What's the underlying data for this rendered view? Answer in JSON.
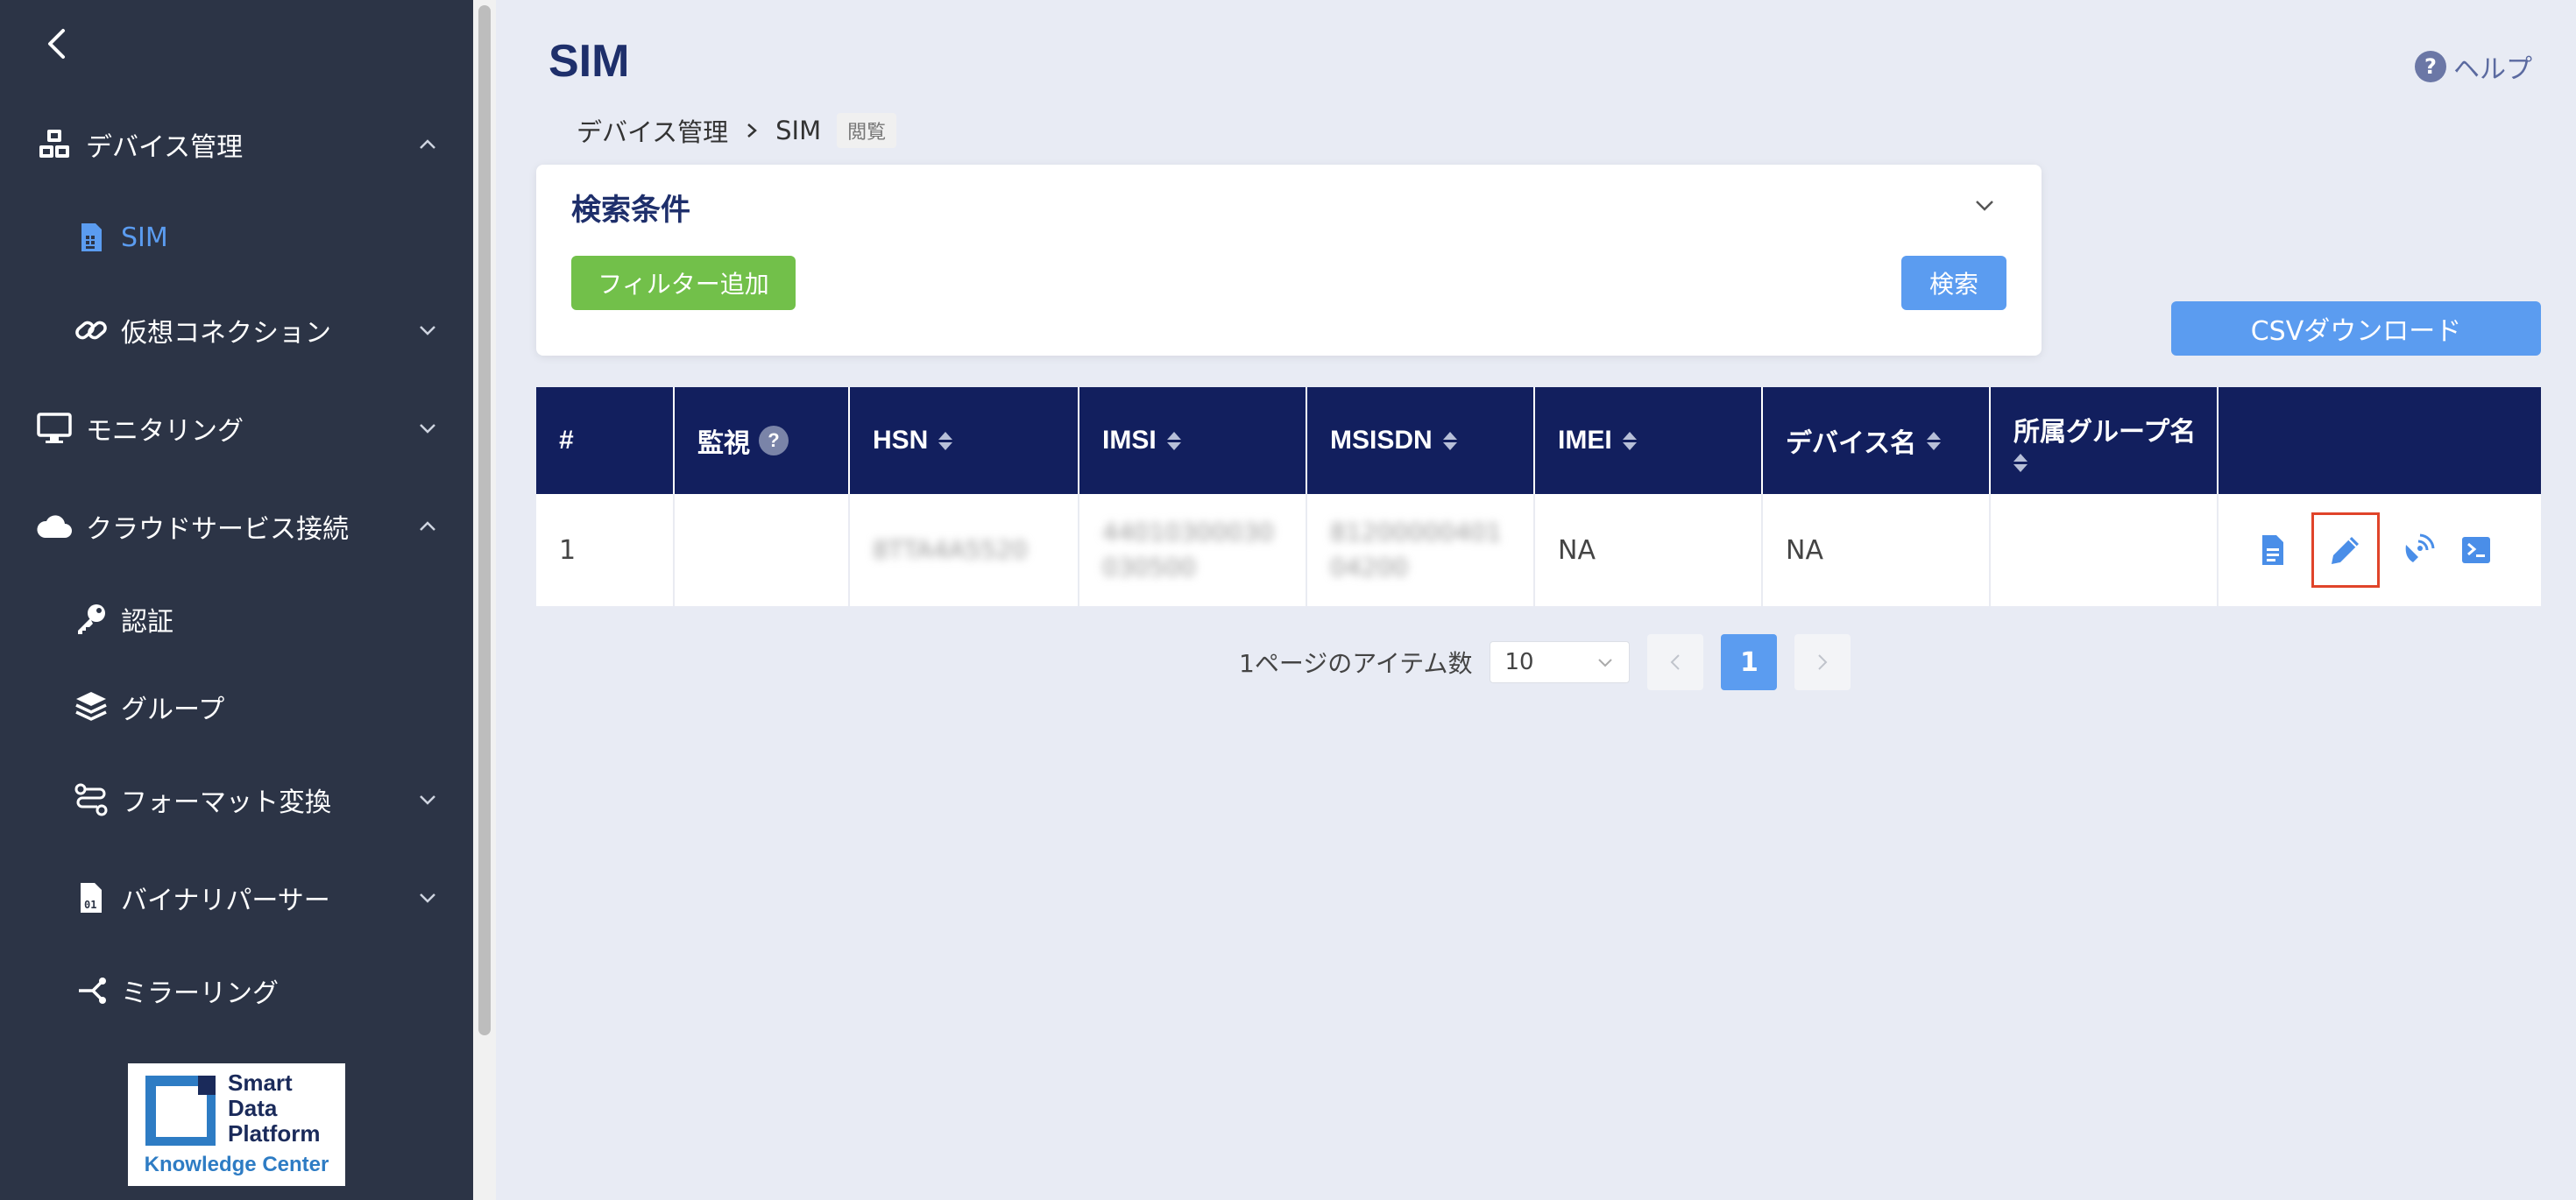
{
  "sidebar": {
    "items": [
      {
        "label": "デバイス管理",
        "icon": "cubes-icon"
      },
      {
        "label": "SIM",
        "icon": "sim-card-icon"
      },
      {
        "label": "仮想コネクション",
        "icon": "link-icon"
      },
      {
        "label": "モニタリング",
        "icon": "monitor-icon"
      },
      {
        "label": "クラウドサービス接続",
        "icon": "cloud-icon"
      },
      {
        "label": "認証",
        "icon": "key-icon"
      },
      {
        "label": "グループ",
        "icon": "layers-icon"
      },
      {
        "label": "フォーマット変換",
        "icon": "route-icon"
      },
      {
        "label": "バイナリパーサー",
        "icon": "binary-file-icon"
      },
      {
        "label": "ミラーリング",
        "icon": "share-icon"
      }
    ],
    "logo": {
      "line1": "Smart",
      "line2": "Data",
      "line3": "Platform",
      "sub": "Knowledge Center"
    }
  },
  "header": {
    "title": "SIM",
    "help": "ヘルプ",
    "help_icon_text": "?",
    "breadcrumb": {
      "root": "デバイス管理",
      "current": "SIM",
      "tag": "閲覧"
    }
  },
  "search": {
    "title": "検索条件",
    "filter_button": "フィルター追加",
    "search_button": "検索"
  },
  "csv_button": "CSVダウンロード",
  "table": {
    "columns": [
      "#",
      "監視",
      "HSN",
      "IMSI",
      "MSISDN",
      "IMEI",
      "デバイス名",
      "所属グループ名"
    ],
    "rows": [
      {
        "no": "1",
        "monitor": "",
        "hsn": "8TTA4A5520",
        "imsi": "44010300030030500",
        "msisdn": "8120000040104200",
        "imei": "NA",
        "device": "NA",
        "group": ""
      }
    ]
  },
  "pagination": {
    "items_label": "1ページのアイテム数",
    "page_size": "10",
    "current_page": "1"
  },
  "colors": {
    "sidebar_bg": "#2c3446",
    "accent": "#5b9cf0",
    "header_navy": "#121f5e",
    "filter_green": "#72c04a",
    "highlight_red": "#e0442a"
  }
}
